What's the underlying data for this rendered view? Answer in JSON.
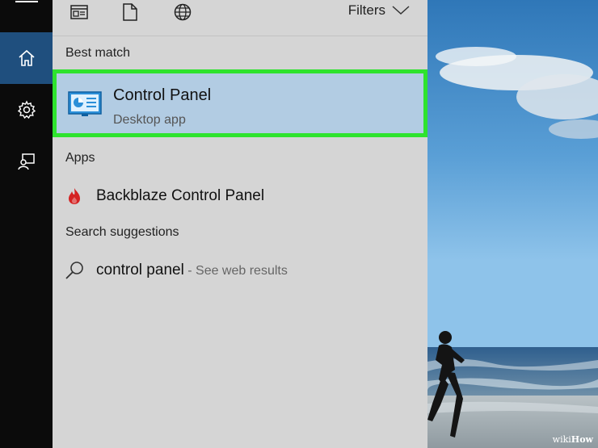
{
  "rail": {
    "items": [
      {
        "name": "menu"
      },
      {
        "name": "home",
        "active": true
      },
      {
        "name": "settings"
      },
      {
        "name": "feedback"
      }
    ]
  },
  "topbar": {
    "icons": [
      "documents-filter-icon",
      "file-icon",
      "globe-icon"
    ],
    "filters_label": "Filters"
  },
  "results": {
    "best_match_heading": "Best match",
    "best_match": {
      "title": "Control Panel",
      "subtitle": "Desktop app",
      "icon": "control-panel-icon"
    },
    "apps_heading": "Apps",
    "apps": [
      {
        "label": "Backblaze Control Panel",
        "icon": "backblaze-flame-icon"
      }
    ],
    "suggestions_heading": "Search suggestions",
    "suggestions": [
      {
        "query": "control panel",
        "hint": " - See web results"
      }
    ]
  },
  "watermark": {
    "prefix": "wiki",
    "suffix": "How"
  },
  "colors": {
    "panel_bg": "#d5d5d5",
    "rail_bg": "#0b0b0b",
    "rail_active": "#1f4f7e",
    "selected_bg": "#b2cce3",
    "highlight_border": "#2ee32e"
  }
}
